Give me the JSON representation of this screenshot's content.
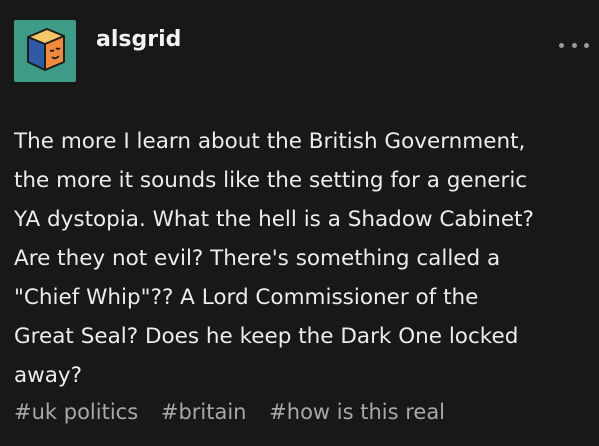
{
  "post": {
    "username": "alsgrid",
    "avatar_icon": "cube-face-icon",
    "more_icon": "more-options-icon",
    "body_lines": [
      "The more I learn about the British Government,",
      "the more it sounds like the setting for a generic",
      "YA dystopia. What the hell is a Shadow Cabinet?",
      "Are they not evil? There's something called a",
      "\"Chief Whip\"?? A Lord Commissioner of the",
      "Great Seal? Does he keep the Dark One locked",
      "away?"
    ],
    "tags": [
      "#uk politics",
      "#britain",
      "#how is this real"
    ]
  },
  "colors": {
    "background": "#181818",
    "text": "#ececec",
    "tag_text": "#a8a8a8",
    "avatar_bg": "#3e9b86"
  }
}
